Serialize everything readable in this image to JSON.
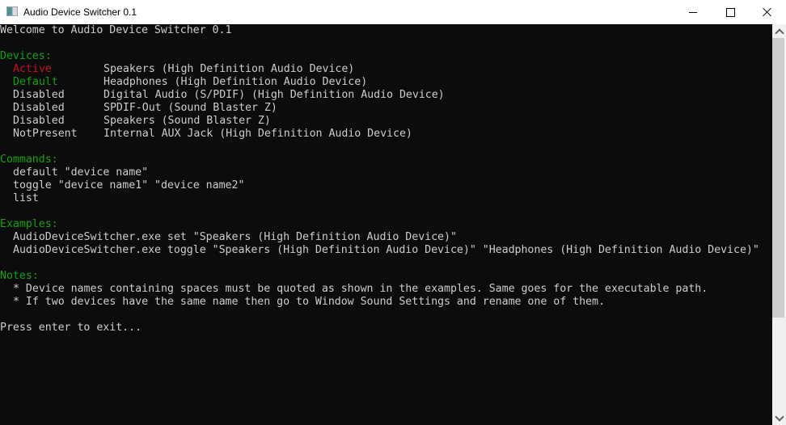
{
  "window": {
    "title": "Audio Device Switcher 0.1",
    "controls": {
      "minimize": "minimize",
      "maximize": "maximize",
      "close": "close"
    }
  },
  "console": {
    "welcome": "Welcome to Audio Device Switcher 0.1",
    "devices": {
      "heading": "Devices:",
      "items": [
        {
          "status": "Active",
          "name": "Speakers (High Definition Audio Device)",
          "status_color": "#c50f1f"
        },
        {
          "status": "Default",
          "name": "Headphones (High Definition Audio Device)",
          "status_color": "#13a10e"
        },
        {
          "status": "Disabled",
          "name": "Digital Audio (S/PDIF) (High Definition Audio Device)",
          "status_color": "#cccccc"
        },
        {
          "status": "Disabled",
          "name": "SPDIF-Out (Sound Blaster Z)",
          "status_color": "#cccccc"
        },
        {
          "status": "Disabled",
          "name": "Speakers (Sound Blaster Z)",
          "status_color": "#cccccc"
        },
        {
          "status": "NotPresent",
          "name": "Internal AUX Jack (High Definition Audio Device)",
          "status_color": "#cccccc"
        }
      ]
    },
    "commands": {
      "heading": "Commands:",
      "items": [
        "default \"device name\"",
        "toggle \"device name1\" \"device name2\"",
        "list"
      ]
    },
    "examples": {
      "heading": "Examples:",
      "items": [
        "AudioDeviceSwitcher.exe set \"Speakers (High Definition Audio Device)\"",
        "AudioDeviceSwitcher.exe toggle \"Speakers (High Definition Audio Device)\" \"Headphones (High Definition Audio Device)\""
      ]
    },
    "notes": {
      "heading": "Notes:",
      "items": [
        "* Device names containing spaces must be quoted as shown in the examples. Same goes for the executable path.",
        "* If two devices have the same name then go to Window Sound Settings and rename one of them."
      ]
    },
    "prompt": "Press enter to exit...",
    "colors": {
      "background": "#0c0c0c",
      "text": "#cccccc",
      "heading": "#13a10e",
      "active": "#c50f1f",
      "default": "#13a10e"
    }
  }
}
